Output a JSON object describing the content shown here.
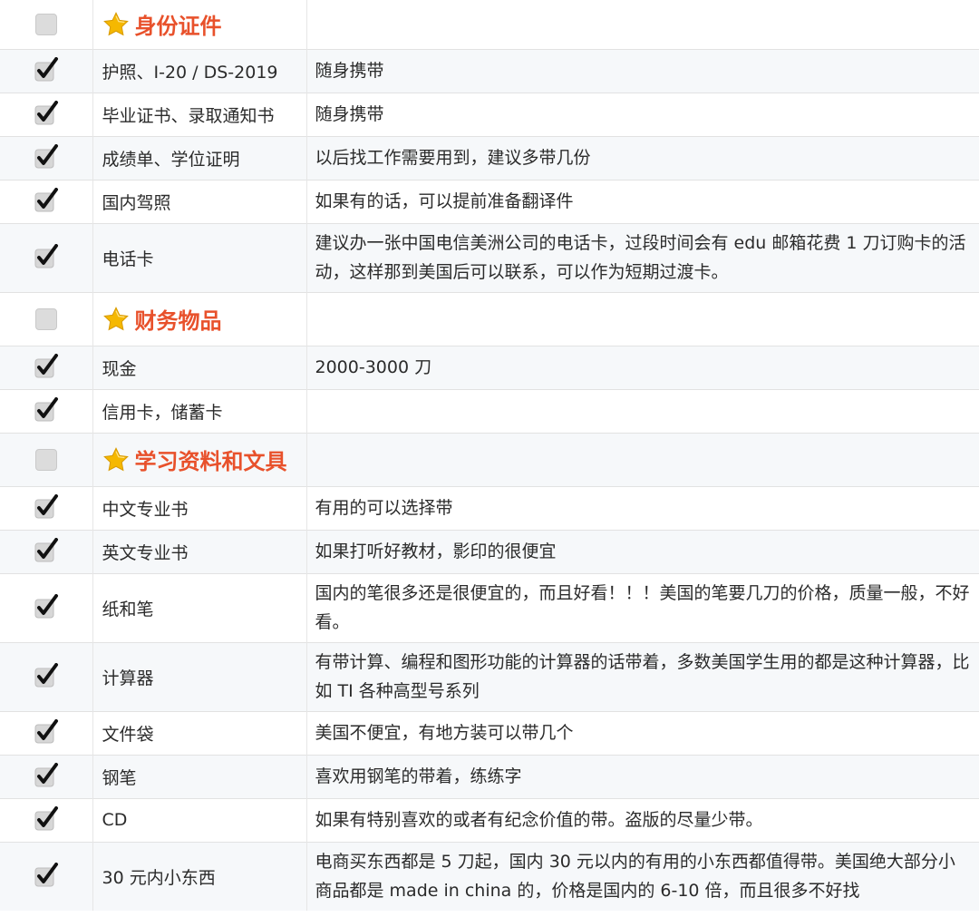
{
  "sections": [
    {
      "title": "身份证件",
      "items": [
        {
          "name": "护照、I-20 / DS-2019",
          "note": "随身携带"
        },
        {
          "name": "毕业证书、录取通知书",
          "note": "随身携带"
        },
        {
          "name": "成绩单、学位证明",
          "note": "以后找工作需要用到，建议多带几份"
        },
        {
          "name": "国内驾照",
          "note": "如果有的话，可以提前准备翻译件"
        },
        {
          "name": "电话卡",
          "note": "建议办一张中国电信美洲公司的电话卡，过段时间会有 edu 邮箱花费 1 刀订购卡的活动，这样那到美国后可以联系，可以作为短期过渡卡。"
        }
      ]
    },
    {
      "title": "财务物品",
      "items": [
        {
          "name": "现金",
          "note": "2000-3000 刀"
        },
        {
          "name": "信用卡，储蓄卡",
          "note": ""
        }
      ]
    },
    {
      "title": "学习资料和文具",
      "items": [
        {
          "name": "中文专业书",
          "note": "有用的可以选择带"
        },
        {
          "name": "英文专业书",
          "note": "如果打听好教材，影印的很便宜"
        },
        {
          "name": "纸和笔",
          "note": "国内的笔很多还是很便宜的，而且好看！！！美国的笔要几刀的价格，质量一般，不好看。"
        },
        {
          "name": "计算器",
          "note": "有带计算、编程和图形功能的计算器的话带着，多数美国学生用的都是这种计算器，比如 TI 各种高型号系列"
        },
        {
          "name": "文件袋",
          "note": "美国不便宜，有地方装可以带几个"
        },
        {
          "name": "钢笔",
          "note": "喜欢用钢笔的带着，练练字"
        },
        {
          "name": "CD",
          "note": "如果有特别喜欢的或者有纪念价值的带。盗版的尽量少带。"
        },
        {
          "name": "30 元内小东西",
          "note": "电商买东西都是 5 刀起，国内 30 元以内的有用的小东西都值得带。美国绝大部分小商品都是 made in china 的，价格是国内的 6-10 倍，而且很多不好找"
        }
      ]
    }
  ],
  "icons": {
    "section_marker": "star-icon",
    "section_checkbox": "checkbox-empty-icon",
    "item_checkbox": "checkmark-icon"
  },
  "colors": {
    "section_title": "#e8512b",
    "alt_row": "#f6f8fa",
    "star": "#f5b800"
  }
}
